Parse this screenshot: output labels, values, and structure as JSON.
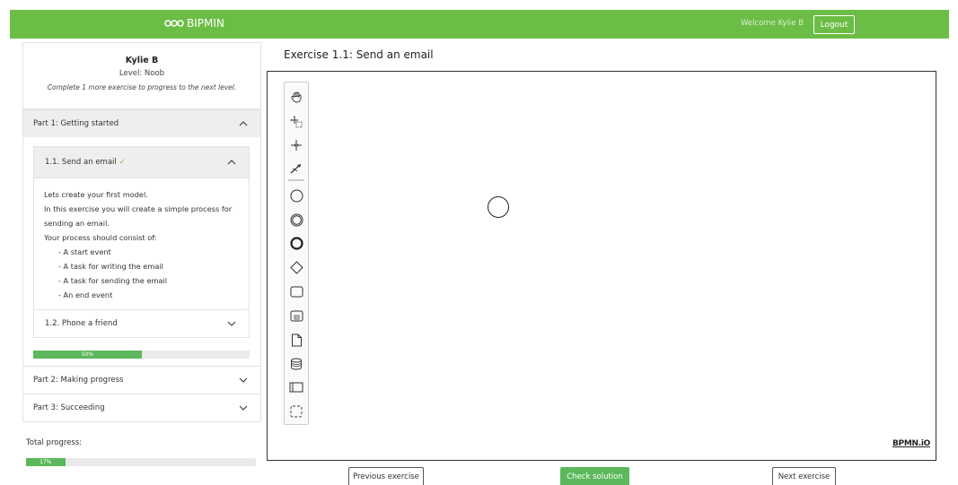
{
  "header": {
    "brand": "BIPMIN",
    "welcome": "Welcome Kylie B",
    "logout_label": "Logout",
    "color": "#6cbd45"
  },
  "user": {
    "name": "Kylie B",
    "level": "Level: Noob",
    "hint": "Complete 1 more exercise to progress to the next level."
  },
  "parts": [
    {
      "label": "Part 1: Getting started",
      "expanded": true,
      "exercises": [
        {
          "label": "1.1. Send an email",
          "done": true,
          "expanded": true,
          "description": [
            "Lets create your first model.",
            "In this exercise you will create a simple process for sending an email.",
            "Your process should consist of:"
          ],
          "items": [
            "- A start event",
            "- A task for writing the email",
            "- A task for sending the email",
            "- An end event"
          ]
        },
        {
          "label": "1.2. Phone a friend",
          "done": false,
          "expanded": false
        }
      ],
      "progress": {
        "value": 0.5,
        "label": "50%"
      }
    },
    {
      "label": "Part 2: Making progress",
      "expanded": false
    },
    {
      "label": "Part 3: Succeeding",
      "expanded": false
    }
  ],
  "total": {
    "label": "Total progress:",
    "value": 0.17,
    "text": "17%"
  },
  "main": {
    "title": "Exercise 1.1: Send an email",
    "watermark": "BPMN.iO",
    "palette": [
      "hand-tool-icon",
      "lasso-tool-icon",
      "space-tool-icon",
      "global-connect-tool-icon",
      "start-event-icon",
      "intermediate-event-icon",
      "end-event-icon",
      "gateway-icon",
      "task-icon",
      "subprocess-icon",
      "data-object-icon",
      "data-store-icon",
      "pool-icon",
      "group-icon"
    ]
  },
  "buttons": {
    "previous": "Previous exercise",
    "check": "Check solution",
    "next": "Next exercise"
  }
}
